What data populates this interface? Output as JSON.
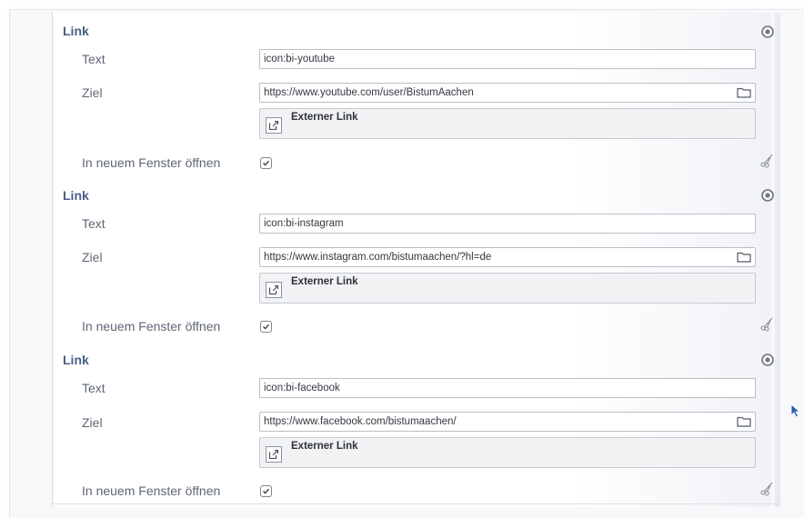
{
  "groups": [
    {
      "heading": "Link",
      "text_label": "Text",
      "text_value": "icon:bi-youtube",
      "target_label": "Ziel",
      "target_value": "https://www.youtube.com/user/BistumAachen",
      "link_type": "Externer Link",
      "new_window_label": "In neuem Fenster öffnen",
      "new_window_checked": true
    },
    {
      "heading": "Link",
      "text_label": "Text",
      "text_value": "icon:bi-instagram",
      "target_label": "Ziel",
      "target_value": "https://www.instagram.com/bistumaachen/?hl=de",
      "link_type": "Externer Link",
      "new_window_label": "In neuem Fenster öffnen",
      "new_window_checked": true
    },
    {
      "heading": "Link",
      "text_label": "Text",
      "text_value": "icon:bi-facebook",
      "target_label": "Ziel",
      "target_value": "https://www.facebook.com/bistumaachen/",
      "link_type": "Externer Link",
      "new_window_label": "In neuem Fenster öffnen",
      "new_window_checked": true
    }
  ],
  "icons": {
    "group_action": "circle-dot-icon",
    "folder": "folder-icon",
    "external_link": "external-link-icon",
    "checkbox": "checkmark-icon",
    "cut": "scissors-icon",
    "cursor": "mouse-cursor-icon"
  },
  "colors": {
    "heading": "#4a5e86",
    "label": "#5f6775",
    "input_border": "#b9bec7",
    "external_box": "#f1f2f4"
  }
}
